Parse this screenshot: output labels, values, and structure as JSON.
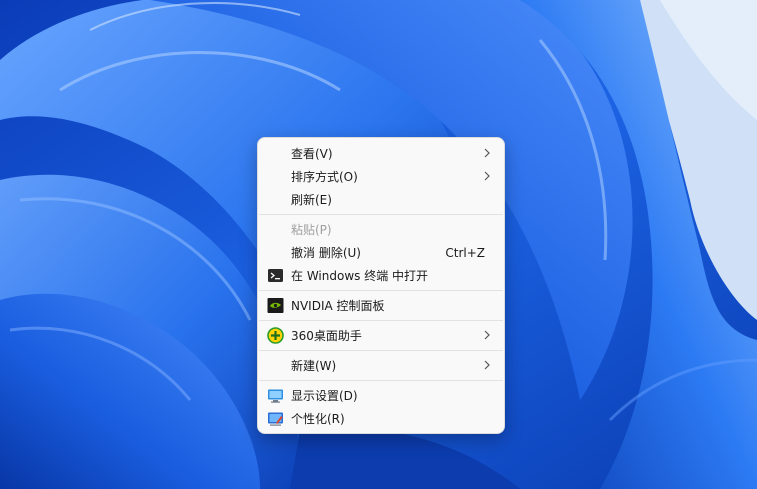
{
  "context_menu": {
    "items": [
      {
        "label": "查看(V)",
        "has_submenu": true
      },
      {
        "label": "排序方式(O)",
        "has_submenu": true
      },
      {
        "label": "刷新(E)"
      },
      {
        "label": "粘贴(P)",
        "disabled": true
      },
      {
        "label": "撤消 删除(U)",
        "shortcut": "Ctrl+Z"
      },
      {
        "label": "在 Windows 终端 中打开",
        "icon": "terminal-icon"
      },
      {
        "label": "NVIDIA 控制面板",
        "icon": "nvidia-icon"
      },
      {
        "label": "360桌面助手",
        "icon": "360-icon",
        "has_submenu": true
      },
      {
        "label": "新建(W)",
        "has_submenu": true
      },
      {
        "label": "显示设置(D)",
        "icon": "display-icon"
      },
      {
        "label": "个性化(R)",
        "icon": "personalize-icon"
      }
    ]
  },
  "colors": {
    "wallpaper_blue": "#1e62e0",
    "menu_bg": "#f9f9f9",
    "disabled_text": "#a0a0a0"
  }
}
